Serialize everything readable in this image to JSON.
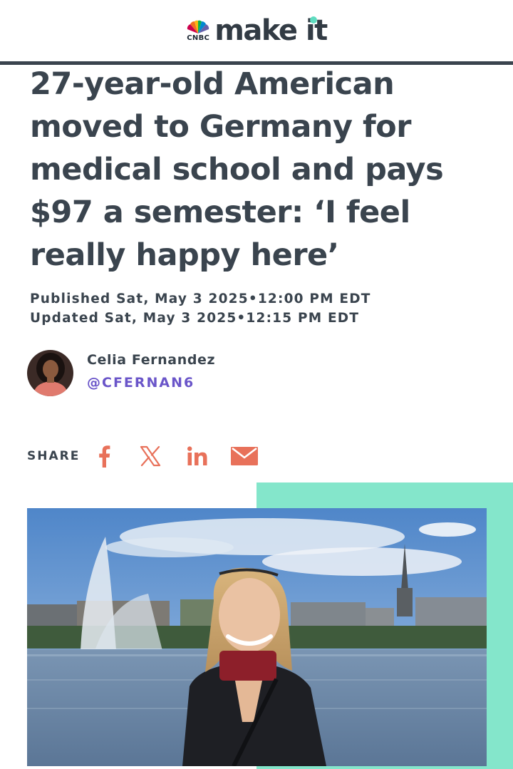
{
  "brand": {
    "network": "CNBC",
    "site": "make it"
  },
  "article": {
    "headline": "27-year-old American moved to Germany for medical school and pays $97 a semester: ‘I feel really happy here’",
    "published": "Published Sat, May 3 2025•12:00 PM EDT",
    "updated": "Updated Sat, May 3 2025•12:15 PM EDT"
  },
  "author": {
    "name": "Celia Fernandez",
    "handle": "@CFERNAN6"
  },
  "share": {
    "label": "SHARE",
    "icons": [
      "facebook-icon",
      "x-icon",
      "linkedin-icon",
      "email-icon"
    ],
    "icon_color": "#e8715a"
  },
  "colors": {
    "text": "#3a444e",
    "handle": "#6a55c9",
    "accent_teal": "#84e6cb"
  }
}
